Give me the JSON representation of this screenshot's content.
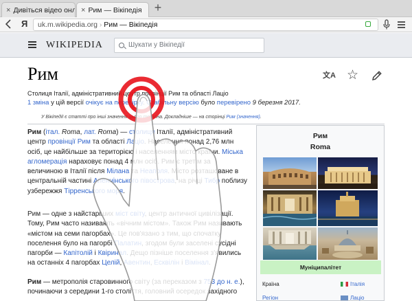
{
  "browser": {
    "tabs": [
      {
        "label": "Дивіться відео онлайн",
        "active": false
      },
      {
        "label": "Рим — Вікіпедія",
        "active": true
      }
    ],
    "new_tab_glyph": "+",
    "close_glyph": "×",
    "yandex_button": "Я",
    "address": {
      "host": "uk.m.wikipedia.org",
      "separator": "›",
      "page_title": "Рим — Вікіпедія"
    },
    "icons": [
      "back-arrow-icon",
      "lock-icon",
      "microphone-icon",
      "menu-icon"
    ]
  },
  "wiki_header": {
    "logo": "WIKIPEDIA",
    "search_placeholder": "Шукати у Вікіпедії"
  },
  "article": {
    "title": "Рим",
    "action_lang_glyph": "文A",
    "action_star_glyph": "☆",
    "lead": "Столиця Італії, адміністративний центр провінції Рим та області Лаціо",
    "update": {
      "changes_link": "1 зміна",
      "middle": " у цій версії ",
      "pending_link": "очікує на перевірку",
      "sep": ". ",
      "stable_link": "Стабільну версію",
      "was": " було ",
      "checked_link": "перевірено",
      "date": " 9 березня 2017."
    },
    "hatnote": {
      "text": "У Вікіпедії є статті про інші значення цього терміна. Докладніше — на сторінці ",
      "link": "Рим (значення)",
      "end": "."
    },
    "p1": {
      "s1": "Рим",
      "s2": " (",
      "l1": "італ.",
      "s3": " ",
      "i1": "Roma",
      "s4": ", ",
      "l2": "лат.",
      "s5": " ",
      "i2": "Roma",
      "s6": ") — ",
      "l3": "столиця",
      "s7": " Італії, адміністративний центр ",
      "l4": "провінції Рим",
      "s8": " та області ",
      "l5": "Лаціо",
      "s9": ". Населення понад 2,76 млн осіб, це найбільше за територією і населенням місто країни. ",
      "l6": "Міська агломерація",
      "s10": " нараховує понад 4 млн осіб. Рим є третім за величиною в Італії після ",
      "l7": "Мілана",
      "s11": " та ",
      "l8": "Неаполя",
      "s12": ". Місто розташоване в центральній частині ",
      "l9": "Апеннінського півострова",
      "s13": ", на річці ",
      "l10": "Тибр",
      "s14": " поблизу узбережжя ",
      "l11": "Тірренського моря",
      "s15": "."
    },
    "p2": {
      "s1": "Рим — одне з найстаріших ",
      "l1": "міст світу",
      "s2": ", центр античної цивілізації. Тому, Рим часто називають «вічним містом». Також Рим називають «містом на семи пагорбах». Це пов'язано з тим, що спочатку поселення було на пагорбі ",
      "l2": "Палатин",
      "s3": ", згодом були заселені сусідні пагорби — ",
      "l3": "Капітолій",
      "s4": " і ",
      "l4": "Квіринал",
      "s5": ". Дещо пізніше поселення з'явились на останніх 4 пагорбах ",
      "l5": "Целій",
      "s6": ", ",
      "l6": "Авентин",
      "s7": ", ",
      "l7": "Есквілін",
      "s8": " і ",
      "l8": "Вімінал",
      "s9": "."
    },
    "p3": {
      "s1": "Рим",
      "s2": " — метрополія старовинного світу (за переказом з ",
      "l1": "753 до н. е.",
      "s3": "), починаючи з середини 1-го століття, головний осередок західного"
    }
  },
  "infobox": {
    "title_uk": "Рим",
    "title_it": "Roma",
    "section": "Муніципалітет",
    "rows": [
      {
        "label": "Країна",
        "value": "Італія"
      },
      {
        "label": "Регіон",
        "value": "Лаціо"
      }
    ],
    "photos": [
      "colosseum-photo",
      "vittoriano-photo",
      "trevi-night-photo",
      "castel-sant-angelo-photo",
      "trevi-fountain-photo",
      "st-peters-aerial-photo"
    ]
  },
  "overlay": {
    "gesture": "tap",
    "tap_color": "#e8141d"
  }
}
